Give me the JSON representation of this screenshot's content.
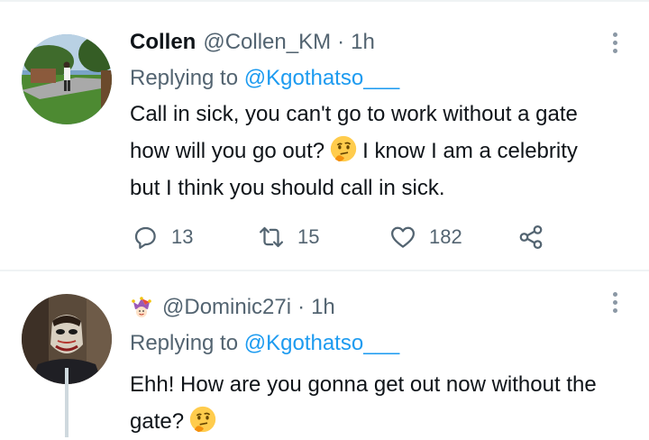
{
  "tweets": [
    {
      "name": "Collen",
      "handle": "@Collen_KM",
      "separator": "·",
      "time": "1h",
      "reply_prefix": "Replying to",
      "reply_to": "@Kgothatso___",
      "text_before_emoji": "Call in sick, you can't go to work without a gate how will you go out?",
      "emoji": "thinking-face",
      "text_after_emoji": "I know I am a celebrity but I think you should call in sick.",
      "actions": {
        "replies": "13",
        "retweets": "15",
        "likes": "182"
      }
    },
    {
      "handle": "@Dominic27i",
      "badge_icon": "jester-icon",
      "separator": "·",
      "time": "1h",
      "reply_prefix": "Replying to",
      "reply_to": "@Kgothatso___",
      "text_before_emoji": "Ehh! How are you gonna get out now without the gate?",
      "emoji": "thinking-face"
    }
  ],
  "colors": {
    "link": "#1d9bf0",
    "secondary_text": "#536471",
    "primary_text": "#0f1419",
    "divider": "#eff3f4"
  }
}
